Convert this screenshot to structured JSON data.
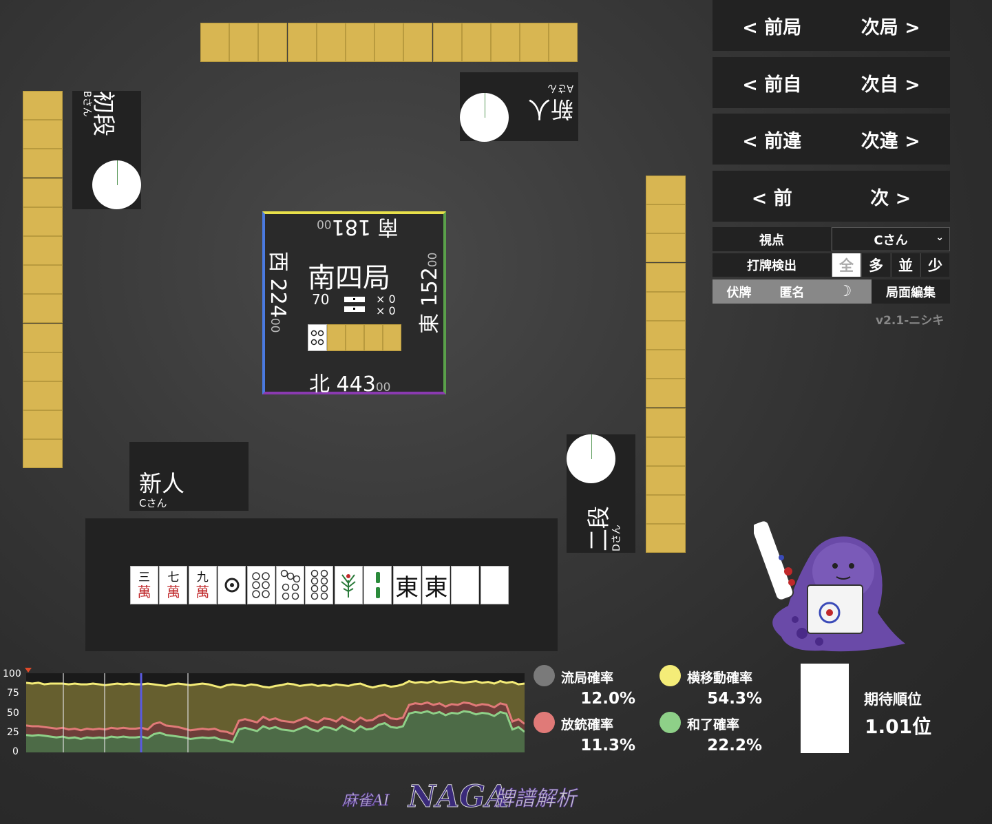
{
  "players": {
    "top": {
      "rank": "新人",
      "name": "Aさん"
    },
    "left": {
      "rank": "初段",
      "name": "Bさん"
    },
    "self": {
      "rank": "新人",
      "name": "Cさん"
    },
    "right": {
      "rank": "二段",
      "name": "Dさん"
    }
  },
  "board": {
    "round": "南四局",
    "honba_count": "70",
    "riichi_x1": "× 0",
    "riichi_x2": "× 0",
    "south": {
      "wind": "南",
      "score": "181",
      "sub": "00"
    },
    "west": {
      "wind": "西",
      "score": "224",
      "sub": "00"
    },
    "east": {
      "wind": "東",
      "score": "152",
      "sub": "00"
    },
    "north": {
      "wind": "北",
      "score": "443",
      "sub": "00"
    }
  },
  "hand": [
    {
      "t": "三",
      "s": "萬"
    },
    {
      "t": "七",
      "s": "萬"
    },
    {
      "t": "九",
      "s": "萬"
    },
    {
      "icon": "pin-1-icon"
    },
    {
      "icon": "pin-6-icon"
    },
    {
      "icon": "pin-7-icon"
    },
    {
      "icon": "pin-8-icon"
    },
    {
      "icon": "sou-1-icon"
    },
    {
      "icon": "sou-2-icon"
    },
    {
      "t": "東"
    },
    {
      "t": "東"
    },
    {
      "blank": true
    },
    {
      "blank": true
    }
  ],
  "nav": {
    "prev_round": "< 前局",
    "next_round": "次局 >",
    "prev_self": "< 前自",
    "next_self": "次自 >",
    "prev_diff": "< 前違",
    "next_diff": "次違 >",
    "prev": "< 前",
    "next": "次 >"
  },
  "controls": {
    "viewpoint_label": "視点",
    "viewpoint_value": "Cさん",
    "detect_label": "打牌検出",
    "detect_options": [
      "全",
      "多",
      "並",
      "少"
    ],
    "hide_tiles": "伏牌",
    "anonymous": "匿名",
    "edit": "局面編集",
    "version": "v2.1-ニシキ"
  },
  "stats": {
    "draw_label": "流局確率",
    "draw_value": "12.0%",
    "deal_in_label": "放銃確率",
    "deal_in_value": "11.3%",
    "move_label": "横移動確率",
    "move_value": "54.3%",
    "win_label": "和了確率",
    "win_value": "22.2%",
    "rank_label": "期待順位",
    "rank_value": "1.01位"
  },
  "colors": {
    "draw": "#7a7a7a",
    "deal_in": "#e07a78",
    "move": "#f4ec78",
    "win": "#8ed088",
    "tile_back": "#d8b652"
  },
  "chart_data": {
    "type": "line",
    "ylim": [
      0,
      100
    ],
    "yticks": [
      "100",
      "75",
      "50",
      "25",
      "0"
    ],
    "series": [
      {
        "key": "move",
        "values": [
          88,
          87,
          88,
          86,
          87,
          87,
          87,
          86,
          87,
          86,
          86,
          87,
          86,
          85,
          86,
          87,
          86,
          87,
          86,
          86,
          87,
          86,
          85,
          84,
          86,
          87,
          86,
          85,
          86,
          87,
          86,
          84,
          82,
          85,
          86,
          85,
          84,
          86,
          85,
          83,
          82,
          84,
          85,
          87,
          86,
          84,
          85,
          86,
          84,
          85,
          84,
          86,
          85,
          84,
          86,
          87,
          84,
          82,
          84,
          85,
          83,
          84,
          86,
          90,
          88,
          89,
          88,
          90,
          88,
          89,
          90,
          89,
          88,
          89,
          90,
          88,
          89,
          87,
          90,
          88,
          89,
          86,
          87
        ]
      },
      {
        "key": "deal_in",
        "values": [
          34,
          33,
          33,
          32,
          31,
          30,
          31,
          29,
          30,
          28,
          30,
          29,
          30,
          29,
          31,
          30,
          31,
          30,
          30,
          31,
          29,
          36,
          38,
          34,
          33,
          32,
          30,
          28,
          29,
          30,
          29,
          30,
          27,
          26,
          23,
          40,
          42,
          40,
          38,
          45,
          41,
          43,
          40,
          39,
          38,
          41,
          44,
          40,
          38,
          43,
          42,
          39,
          45,
          41,
          38,
          44,
          40,
          41,
          46,
          48,
          43,
          42,
          44,
          60,
          62,
          61,
          63,
          60,
          62,
          58,
          61,
          60,
          63,
          62,
          59,
          61,
          60,
          57,
          62,
          60,
          39,
          42,
          36
        ]
      },
      {
        "key": "win",
        "values": [
          22,
          21,
          22,
          21,
          20,
          19,
          20,
          18,
          19,
          17,
          19,
          18,
          19,
          18,
          20,
          19,
          20,
          19,
          19,
          20,
          18,
          23,
          25,
          22,
          21,
          20,
          19,
          17,
          18,
          19,
          18,
          19,
          16,
          15,
          13,
          29,
          31,
          29,
          27,
          33,
          30,
          32,
          29,
          28,
          27,
          30,
          33,
          29,
          27,
          32,
          31,
          28,
          34,
          30,
          27,
          33,
          29,
          30,
          35,
          37,
          32,
          31,
          33,
          49,
          51,
          50,
          52,
          49,
          51,
          47,
          50,
          49,
          52,
          51,
          48,
          50,
          49,
          46,
          51,
          49,
          29,
          32,
          26
        ]
      }
    ]
  }
}
